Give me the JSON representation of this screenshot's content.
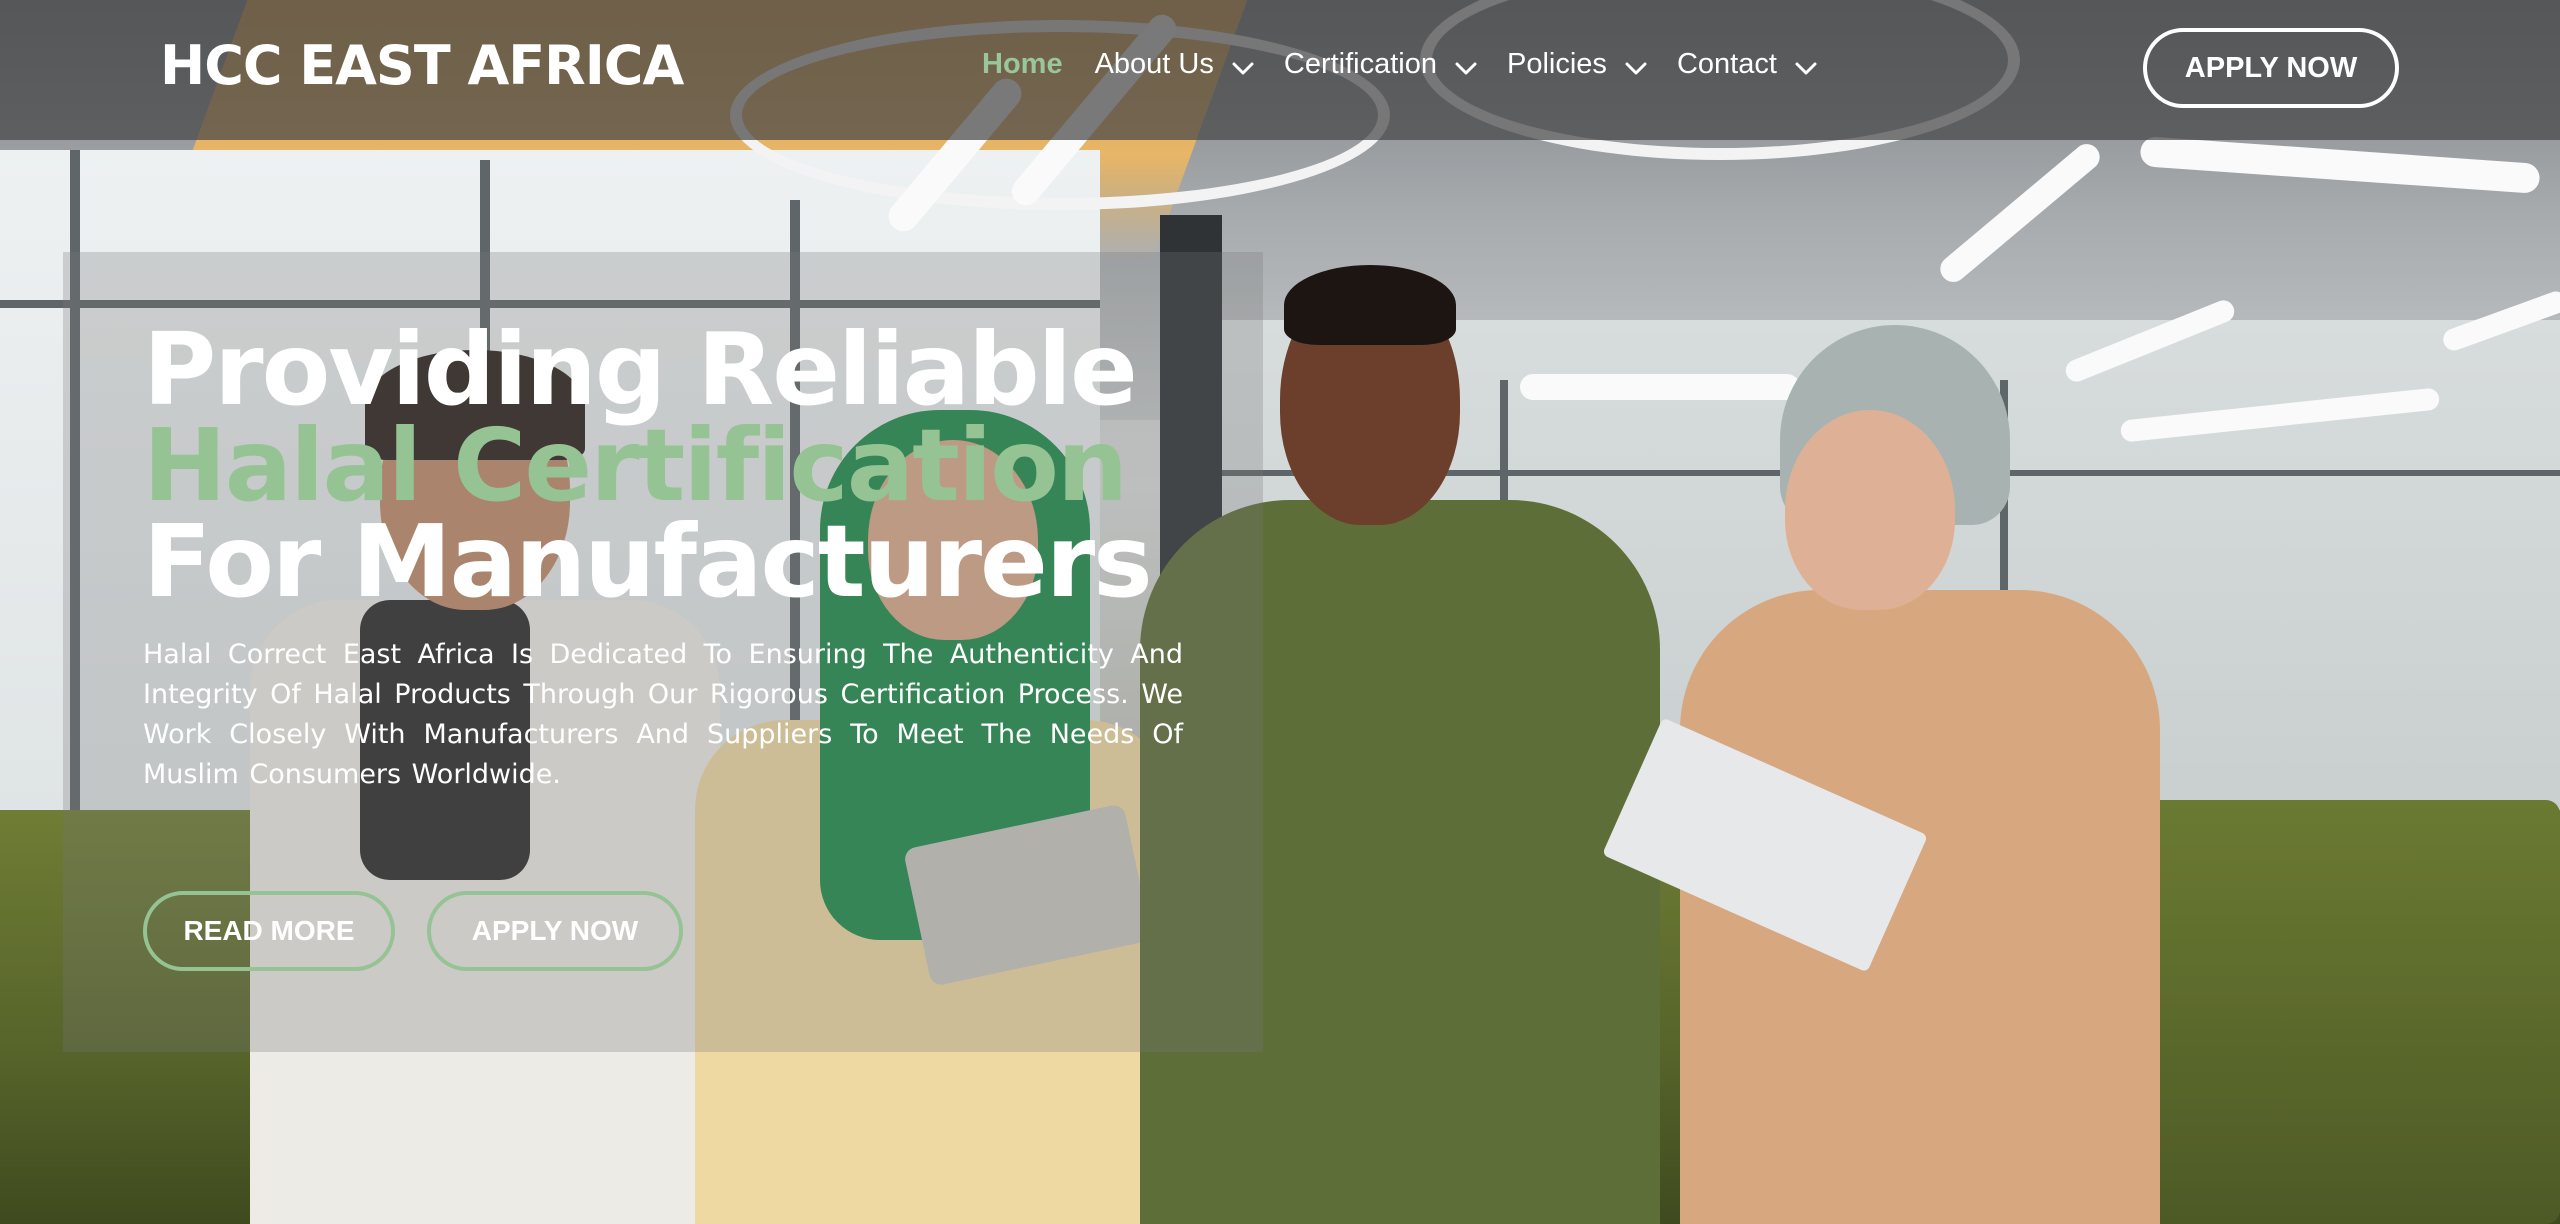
{
  "brand": {
    "name": "HCC EAST AFRICA"
  },
  "nav": {
    "items": [
      {
        "label": "Home",
        "active": true,
        "dropdown": false
      },
      {
        "label": "About Us",
        "active": false,
        "dropdown": true
      },
      {
        "label": "Certification",
        "active": false,
        "dropdown": true
      },
      {
        "label": "Policies",
        "active": false,
        "dropdown": true
      },
      {
        "label": "Contact",
        "active": false,
        "dropdown": true
      }
    ],
    "apply_label": "APPLY NOW"
  },
  "hero": {
    "title_line1": "Providing Reliable",
    "title_line2": "Halal Certification",
    "title_line3": "For Manufacturers",
    "description": "Halal Correct East Africa Is Dedicated To Ensuring The Authenticity And Integrity Of Halal Products Through Our Rigorous Certification Process. We Work Closely With Manufacturers And Suppliers To Meet The Needs Of Muslim Consumers Worldwide.",
    "read_more_label": "READ MORE",
    "apply_label": "APPLY NOW"
  },
  "colors": {
    "accent": "#96c393",
    "nav_active": "#9bc59a",
    "navbar_bg": "#464648",
    "text": "#ffffff"
  },
  "icons": {
    "dropdown": "chevron-down-icon"
  }
}
